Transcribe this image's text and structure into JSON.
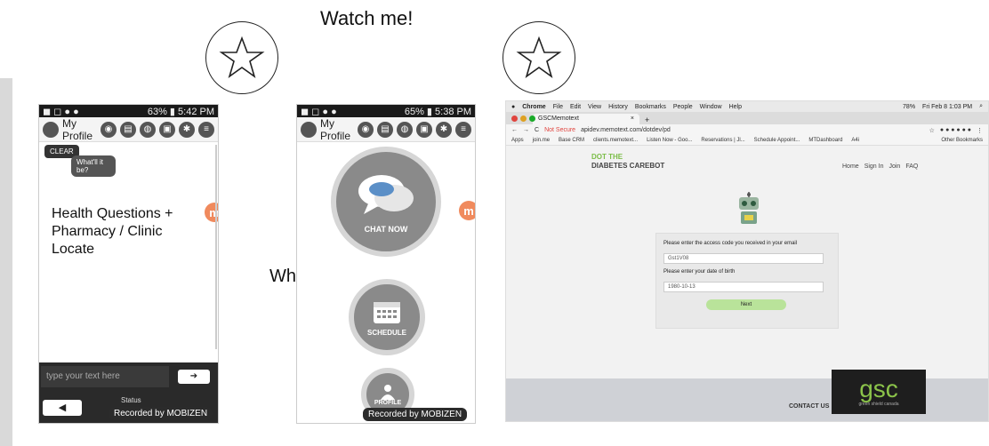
{
  "annotations": {
    "watch": "Watch me!",
    "why": "Why??",
    "health": "Health Questions + Pharmacy / Clinic Locate"
  },
  "phone1": {
    "status_time": "5:42 PM",
    "status_batt": "63%",
    "title": "My Profile",
    "clear": "CLEAR",
    "bubble": "What'll it be?",
    "input_placeholder": "type your text here",
    "status_label": "Status",
    "recorded": "Recorded by MOBIZEN"
  },
  "phone2": {
    "status_time": "5:38 PM",
    "status_batt": "65%",
    "title": "My Profile",
    "chat_now": "CHAT NOW",
    "schedule": "SCHEDULE",
    "profile": "PROFILE",
    "recorded": "Recorded by MOBIZEN"
  },
  "browser": {
    "menu": [
      "Chrome",
      "File",
      "Edit",
      "View",
      "History",
      "Bookmarks",
      "People",
      "Window",
      "Help"
    ],
    "clock": "Fri Feb 8 1:03 PM",
    "battery": "78%",
    "tab_title": "GSCMemotext",
    "not_secure": "Not Secure",
    "url": "apidev.memotext.com/dotdev/pd",
    "bookmarks": [
      "Apps",
      "join.me",
      "Base CRM",
      "clients.memotext...",
      "Listen Now - Goo...",
      "Reservations | Jl...",
      "Schedule Appoint...",
      "MTDashboard",
      "A4i",
      "Other Bookmarks"
    ],
    "logo_top": "DOT THE",
    "logo_bottom": "DIABETES CAREBOT",
    "nav": [
      "Home",
      "Sign In",
      "Join",
      "FAQ"
    ],
    "label_code": "Please enter the access code you received in your email",
    "value_code": "Gst1V08",
    "label_dob": "Please enter your date of birth",
    "value_dob": "1980-10-13",
    "next": "Next",
    "contact": "CONTACT US",
    "gsc": "gsc",
    "gsc_sub": "green shield canada"
  },
  "colors": {
    "accent_orange": "#f08a5d",
    "next_green": "#b9e39a",
    "chrome_red": "#e0443e"
  }
}
